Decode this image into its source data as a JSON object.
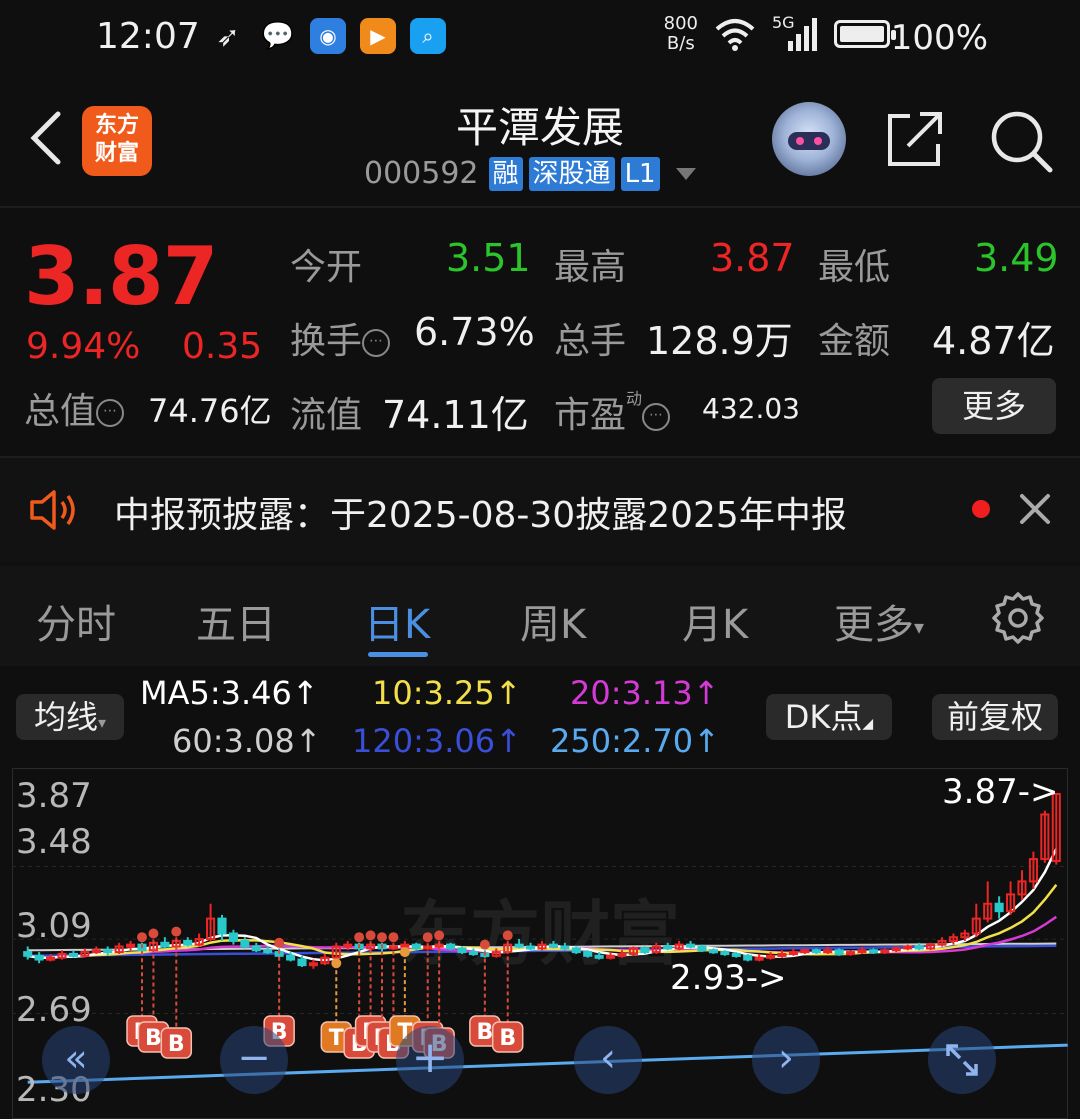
{
  "status_bar": {
    "time": "12:07",
    "net_speed_top": "800",
    "net_speed_bottom": "B/s",
    "network": "5G",
    "battery": "100%"
  },
  "header": {
    "logo_line1": "东方",
    "logo_line2": "财富",
    "stock_name": "平潭发展",
    "stock_code": "000592",
    "badges": [
      "融",
      "深股通",
      "L1"
    ]
  },
  "quote": {
    "price": "3.87",
    "change_pct": "9.94%",
    "change": "0.35",
    "open_label": "今开",
    "open": "3.51",
    "high_label": "最高",
    "high": "3.87",
    "low_label": "最低",
    "low": "3.49",
    "turnover_label": "换手",
    "turnover": "6.73%",
    "volume_label": "总手",
    "volume": "128.9万",
    "amount_label": "金额",
    "amount": "4.87亿",
    "mktcap_label": "总值",
    "mktcap": "74.76亿",
    "float_label": "流值",
    "float_cap": "74.11亿",
    "pe_label": "市盈",
    "pe_super": "动",
    "pe": "432.03",
    "more_label": "更多"
  },
  "notice": {
    "text": "中报预披露：于2025-08-30披露2025年中报"
  },
  "tabs": [
    "分时",
    "五日",
    "日K",
    "周K",
    "月K",
    "更多"
  ],
  "active_tab": "日K",
  "chart_header": {
    "indicator_label": "均线",
    "ma5": "MA5:3.46↑",
    "ma10": "10:3.25↑",
    "ma20": "20:3.13↑",
    "ma60": "60:3.08↑",
    "ma120": "120:3.06↑",
    "ma250": "250:2.70↑",
    "dk_label": "DK点",
    "adjust_label": "前复权"
  },
  "colors": {
    "up": "#ec2525",
    "down": "#2bc42b",
    "accent": "#4b8fe2",
    "ma5": "#ffffff",
    "ma10": "#f2e04b",
    "ma20": "#d63ad6",
    "ma60": "#cfcfcf",
    "ma120": "#3a4fd8",
    "ma250": "#5aaaf0"
  },
  "chart_data": {
    "type": "candlestick",
    "y_ticks": [
      "3.87",
      "3.48",
      "3.09",
      "2.69",
      "2.30"
    ],
    "ylim": [
      2.3,
      3.87
    ],
    "high_marker": "3.87->",
    "low_marker": "2.93->",
    "watermark": "东方财富",
    "candles": [
      [
        3.02,
        3.0,
        3.05,
        2.98
      ],
      [
        3.0,
        2.98,
        3.02,
        2.96
      ],
      [
        2.98,
        2.99,
        3.01,
        2.97
      ],
      [
        2.99,
        3.01,
        3.03,
        2.98
      ],
      [
        3.01,
        3.0,
        3.03,
        2.99
      ],
      [
        3.0,
        3.02,
        3.04,
        2.99
      ],
      [
        3.02,
        3.03,
        3.05,
        3.01
      ],
      [
        3.03,
        3.02,
        3.05,
        3.0
      ],
      [
        3.02,
        3.05,
        3.07,
        3.01
      ],
      [
        3.05,
        3.06,
        3.08,
        3.03
      ],
      [
        3.06,
        3.03,
        3.07,
        3.02
      ],
      [
        3.03,
        3.07,
        3.09,
        3.02
      ],
      [
        3.07,
        3.05,
        3.1,
        3.04
      ],
      [
        3.05,
        3.08,
        3.1,
        3.04
      ],
      [
        3.08,
        3.06,
        3.1,
        3.05
      ],
      [
        3.06,
        3.09,
        3.12,
        3.05
      ],
      [
        3.09,
        3.2,
        3.28,
        3.08
      ],
      [
        3.2,
        3.12,
        3.22,
        3.08
      ],
      [
        3.12,
        3.08,
        3.14,
        3.06
      ],
      [
        3.08,
        3.05,
        3.1,
        3.04
      ],
      [
        3.05,
        3.03,
        3.07,
        3.02
      ],
      [
        3.03,
        3.02,
        3.05,
        3.01
      ],
      [
        3.02,
        3.0,
        3.04,
        2.99
      ],
      [
        3.0,
        2.98,
        3.02,
        2.97
      ],
      [
        2.98,
        2.95,
        3.0,
        2.94
      ],
      [
        2.95,
        2.96,
        2.98,
        2.93
      ],
      [
        2.96,
        2.99,
        3.01,
        2.95
      ],
      [
        2.99,
        3.05,
        3.07,
        2.98
      ],
      [
        3.05,
        3.06,
        3.08,
        3.03
      ],
      [
        3.06,
        3.04,
        3.07,
        3.02
      ],
      [
        3.04,
        3.06,
        3.08,
        3.03
      ],
      [
        3.06,
        3.04,
        3.07,
        3.02
      ],
      [
        3.04,
        3.05,
        3.07,
        3.03
      ],
      [
        3.05,
        3.06,
        3.08,
        3.04
      ],
      [
        3.06,
        3.04,
        3.07,
        3.03
      ],
      [
        3.04,
        3.05,
        3.07,
        3.03
      ],
      [
        3.05,
        3.06,
        3.08,
        3.04
      ],
      [
        3.06,
        3.04,
        3.07,
        3.03
      ],
      [
        3.04,
        3.02,
        3.05,
        3.01
      ],
      [
        3.02,
        3.01,
        3.04,
        3.0
      ],
      [
        3.01,
        3.0,
        3.03,
        2.99
      ],
      [
        3.0,
        3.02,
        3.04,
        2.99
      ],
      [
        3.02,
        3.06,
        3.08,
        3.01
      ],
      [
        3.06,
        3.05,
        3.09,
        3.04
      ],
      [
        3.05,
        3.04,
        3.07,
        3.03
      ],
      [
        3.04,
        3.06,
        3.08,
        3.03
      ],
      [
        3.06,
        3.05,
        3.08,
        3.04
      ],
      [
        3.05,
        3.04,
        3.07,
        3.03
      ],
      [
        3.04,
        3.02,
        3.05,
        3.01
      ],
      [
        3.02,
        3.0,
        3.03,
        2.99
      ],
      [
        3.0,
        2.99,
        3.02,
        2.98
      ],
      [
        2.99,
        3.0,
        3.02,
        2.98
      ],
      [
        3.0,
        3.01,
        3.03,
        2.99
      ],
      [
        3.01,
        3.04,
        3.05,
        3.0
      ],
      [
        3.04,
        3.02,
        3.05,
        3.01
      ],
      [
        3.02,
        3.05,
        3.07,
        3.01
      ],
      [
        3.05,
        3.04,
        3.07,
        3.03
      ],
      [
        3.04,
        3.06,
        3.08,
        3.03
      ],
      [
        3.06,
        3.05,
        3.08,
        3.04
      ],
      [
        3.05,
        3.03,
        3.06,
        3.02
      ],
      [
        3.03,
        3.02,
        3.04,
        3.01
      ],
      [
        3.02,
        3.01,
        3.03,
        3.0
      ],
      [
        3.01,
        3.0,
        3.02,
        2.99
      ],
      [
        3.0,
        2.98,
        3.01,
        2.97
      ],
      [
        2.98,
        2.99,
        3.01,
        2.97
      ],
      [
        2.99,
        3.0,
        3.02,
        2.98
      ],
      [
        3.0,
        3.01,
        3.03,
        2.99
      ],
      [
        3.01,
        3.02,
        3.04,
        3.0
      ],
      [
        3.02,
        3.03,
        3.04,
        3.01
      ],
      [
        3.03,
        3.02,
        3.04,
        3.01
      ],
      [
        3.02,
        3.03,
        3.05,
        3.01
      ],
      [
        3.03,
        3.01,
        3.04,
        3.0
      ],
      [
        3.01,
        3.02,
        3.03,
        3.0
      ],
      [
        3.02,
        3.03,
        3.05,
        3.01
      ],
      [
        3.03,
        3.02,
        3.04,
        3.01
      ],
      [
        3.02,
        3.03,
        3.04,
        3.01
      ],
      [
        3.03,
        3.04,
        3.05,
        3.02
      ],
      [
        3.04,
        3.05,
        3.06,
        3.03
      ],
      [
        3.05,
        3.04,
        3.07,
        3.03
      ],
      [
        3.04,
        3.06,
        3.07,
        3.03
      ],
      [
        3.06,
        3.08,
        3.1,
        3.05
      ],
      [
        3.08,
        3.1,
        3.12,
        3.06
      ],
      [
        3.1,
        3.12,
        3.14,
        3.08
      ],
      [
        3.12,
        3.2,
        3.28,
        3.1
      ],
      [
        3.2,
        3.28,
        3.4,
        3.18
      ],
      [
        3.28,
        3.24,
        3.32,
        3.2
      ],
      [
        3.24,
        3.33,
        3.4,
        3.22
      ],
      [
        3.33,
        3.4,
        3.46,
        3.3
      ],
      [
        3.4,
        3.52,
        3.56,
        3.36
      ],
      [
        3.52,
        3.76,
        3.78,
        3.5
      ],
      [
        3.51,
        3.87,
        3.87,
        3.49
      ]
    ],
    "signals": [
      {
        "i": 10,
        "label": "B"
      },
      {
        "i": 11,
        "label": "B"
      },
      {
        "i": 13,
        "label": "B"
      },
      {
        "i": 22,
        "label": "B"
      },
      {
        "i": 27,
        "label": "T"
      },
      {
        "i": 29,
        "label": "B"
      },
      {
        "i": 30,
        "label": "B"
      },
      {
        "i": 31,
        "label": "B"
      },
      {
        "i": 32,
        "label": "B"
      },
      {
        "i": 33,
        "label": "T"
      },
      {
        "i": 35,
        "label": "B"
      },
      {
        "i": 36,
        "label": "B"
      },
      {
        "i": 40,
        "label": "B"
      },
      {
        "i": 42,
        "label": "B"
      }
    ],
    "ma250": [
      [
        0,
        2.32
      ],
      [
        91,
        2.52
      ]
    ]
  }
}
